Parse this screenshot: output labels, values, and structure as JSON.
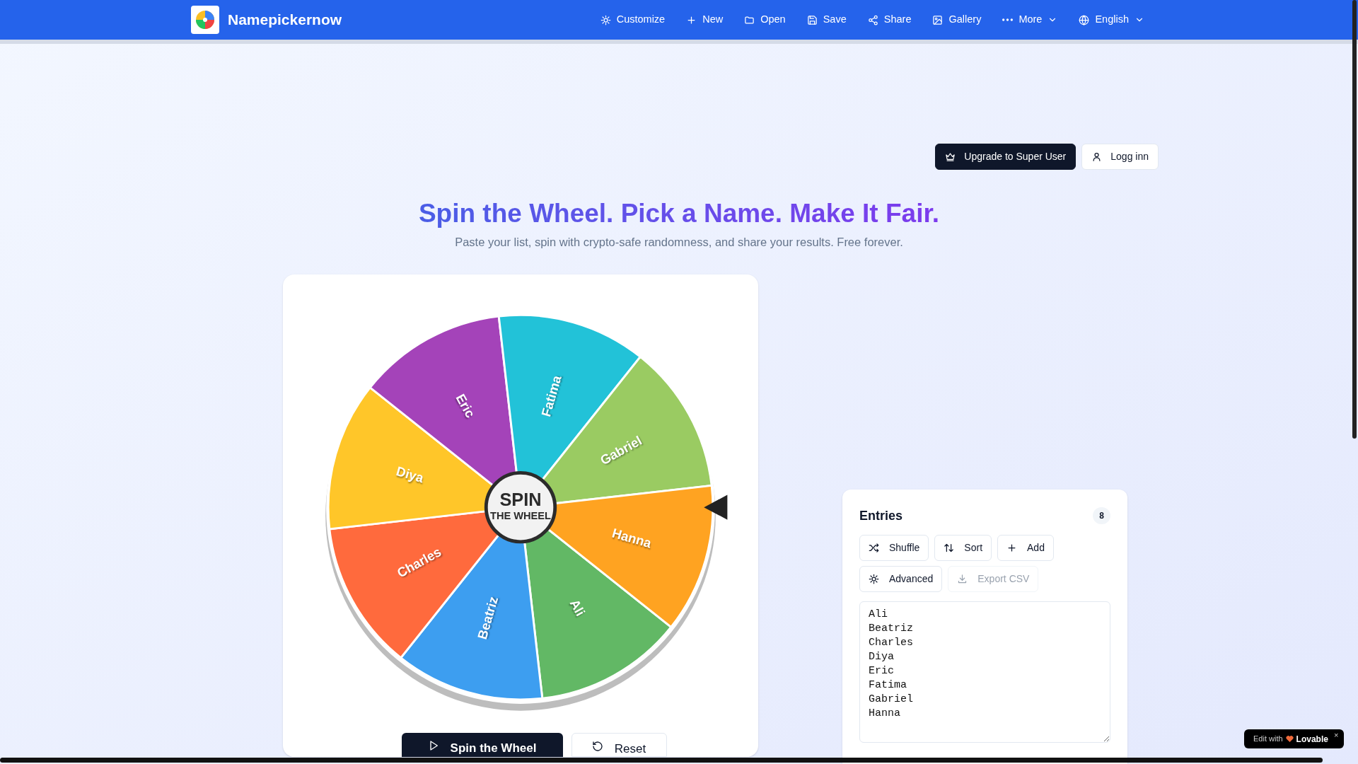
{
  "header": {
    "title": "Namepickernow",
    "nav": [
      {
        "label": "Customize",
        "dropdown": false
      },
      {
        "label": "New",
        "dropdown": false
      },
      {
        "label": "Open",
        "dropdown": false
      },
      {
        "label": "Save",
        "dropdown": false
      },
      {
        "label": "Share",
        "dropdown": false
      },
      {
        "label": "Gallery",
        "dropdown": false
      },
      {
        "label": "More",
        "dropdown": true
      },
      {
        "label": "English",
        "dropdown": true
      }
    ]
  },
  "account": [
    {
      "label": "Upgrade to Super User",
      "kind": "primary"
    },
    {
      "label": "Logg inn",
      "kind": "secondary"
    }
  ],
  "hero": {
    "title": "Spin the Wheel. Pick a Name. Make It Fair.",
    "subtitle": "Paste your list, spin with crypto-safe randomness, and share your results. Free forever."
  },
  "wheel": {
    "center_top": "SPIN",
    "center_bottom": "THE WHEEL",
    "segments": [
      {
        "label": "Ali",
        "color": "#62b865"
      },
      {
        "label": "Beatriz",
        "color": "#3d9ef0"
      },
      {
        "label": "Charles",
        "color": "#ff6a3d"
      },
      {
        "label": "Diya",
        "color": "#ffc629"
      },
      {
        "label": "Eric",
        "color": "#a443b9"
      },
      {
        "label": "Fatima",
        "color": "#22c2d8"
      },
      {
        "label": "Gabriel",
        "color": "#9acb62"
      },
      {
        "label": "Hanna",
        "color": "#ffa321"
      }
    ]
  },
  "wheel_actions": [
    {
      "label": "Spin the Wheel",
      "kind": "primary"
    },
    {
      "label": "Reset",
      "kind": "secondary"
    }
  ],
  "entries": {
    "title": "Entries",
    "count": "8",
    "actions": [
      {
        "label": "Shuffle",
        "disabled": false
      },
      {
        "label": "Sort",
        "disabled": false
      },
      {
        "label": "Add",
        "disabled": false
      },
      {
        "label": "Advanced",
        "disabled": false
      },
      {
        "label": "Export CSV",
        "disabled": true
      }
    ],
    "text": "Ali\nBeatriz\nCharles\nDiya\nEric\nFatima\nGabriel\nHanna"
  },
  "badge": {
    "prefix": "Edit with",
    "brand": "Lovable",
    "close": "×"
  }
}
